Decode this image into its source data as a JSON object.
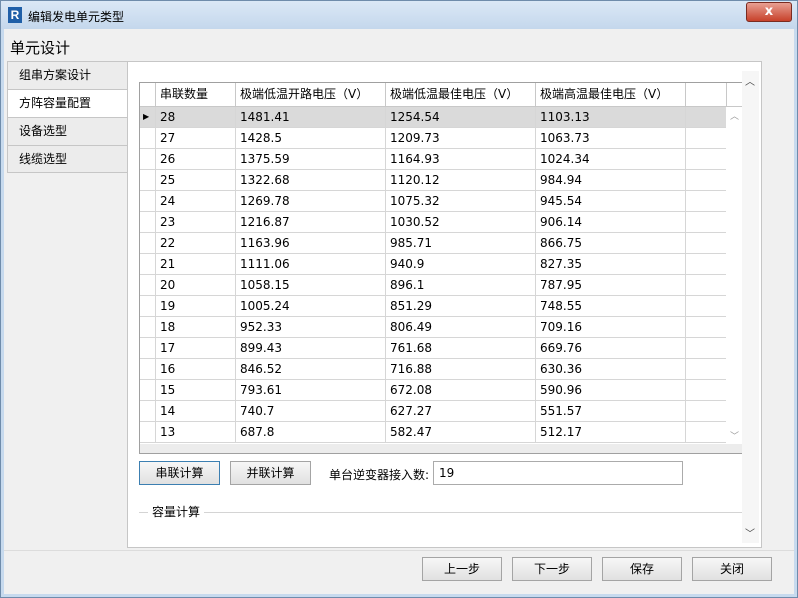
{
  "window": {
    "title": "编辑发电单元类型",
    "app_icon": "R",
    "close_glyph": "x"
  },
  "section_title": "单元设计",
  "nav": [
    {
      "label": "组串方案设计",
      "active": false
    },
    {
      "label": "方阵容量配置",
      "active": true
    },
    {
      "label": "设备选型",
      "active": false
    },
    {
      "label": "线缆选型",
      "active": false
    }
  ],
  "table": {
    "headers": [
      "串联数量",
      "极端低温开路电压（V）",
      "极端低温最佳电压（V）",
      "极端高温最佳电压（V）"
    ],
    "rows": [
      [
        "28",
        "1481.41",
        "1254.54",
        "1103.13"
      ],
      [
        "27",
        "1428.5",
        "1209.73",
        "1063.73"
      ],
      [
        "26",
        "1375.59",
        "1164.93",
        "1024.34"
      ],
      [
        "25",
        "1322.68",
        "1120.12",
        "984.94"
      ],
      [
        "24",
        "1269.78",
        "1075.32",
        "945.54"
      ],
      [
        "23",
        "1216.87",
        "1030.52",
        "906.14"
      ],
      [
        "22",
        "1163.96",
        "985.71",
        "866.75"
      ],
      [
        "21",
        "1111.06",
        "940.9",
        "827.35"
      ],
      [
        "20",
        "1058.15",
        "896.1",
        "787.95"
      ],
      [
        "19",
        "1005.24",
        "851.29",
        "748.55"
      ],
      [
        "18",
        "952.33",
        "806.49",
        "709.16"
      ],
      [
        "17",
        "899.43",
        "761.68",
        "669.76"
      ],
      [
        "16",
        "846.52",
        "716.88",
        "630.36"
      ],
      [
        "15",
        "793.61",
        "672.08",
        "590.96"
      ],
      [
        "14",
        "740.7",
        "627.27",
        "551.57"
      ],
      [
        "13",
        "687.8",
        "582.47",
        "512.17"
      ]
    ],
    "selected_row_indicator": "▶"
  },
  "controls": {
    "series_calc": "串联计算",
    "parallel_calc": "并联计算",
    "inverter_input_label": "单台逆变器接入数:",
    "inverter_input_value": "19"
  },
  "capacity_group_title": "容量计算",
  "footer": {
    "prev": "上一步",
    "next": "下一步",
    "save": "保存",
    "close": "关闭"
  },
  "colors": {
    "title_bar": "#c4d7ec",
    "close_button": "#c7412a",
    "selected_row": "#dadada"
  }
}
